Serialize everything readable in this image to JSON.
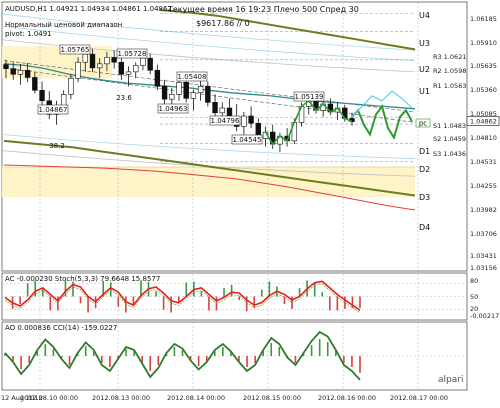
{
  "header": {
    "title": "AUDUSD,H1  1.04921 1.04934 1.04861 1.04862",
    "indicator_name": "Нормальный ценовой диапазон",
    "pivot_label": "pivot: 1.0491",
    "server_time": "Текущее время 16 19:23 Плечо 500 Спред 30",
    "balance": "$9617.86  // 0"
  },
  "colors": {
    "background": "#ffffff",
    "candle": "#111111",
    "ema_teal": "#2a8c8c",
    "ema_olive": "#6b7d1e",
    "ema_red": "#e0403a",
    "forecast_green": "#2e9a2e",
    "forecast_cyan": "#66ccee",
    "band_yellow": "#fff3c8",
    "osc_red": "#e02020",
    "hist_red": "#d84040",
    "hist_green": "#3a9a3a",
    "grid": "#9aa9c8"
  },
  "chart_data": [
    {
      "type": "candlestick",
      "title": "AUDUSD,H1",
      "price_axis": [
        "1.06185",
        "1.05910",
        "1.05635",
        "1.05360",
        "1.05085",
        "1.04810",
        "1.04531",
        "1.04255",
        "1.03982",
        "1.03706",
        "1.03431",
        "1.03156"
      ],
      "level_labels": [
        "U4",
        "U3",
        "U2",
        "U1",
        "D1",
        "D2",
        "D3",
        "D4"
      ],
      "pivot_labels": [
        "R3 1.0621",
        "R2 1.0598",
        "R1 1.0563",
        "S1 1.0483",
        "S2 1.0459",
        "S3 1.0436"
      ],
      "price_annotations": [
        "1.05765",
        "1.05728",
        "1.05408",
        "1.05139",
        "1.04963",
        "1.04796",
        "1.04867",
        "1.04545"
      ],
      "text_annotations": [
        "23.6",
        "38.2",
        "pc",
        "1.04862"
      ],
      "y_range": [
        1.03,
        1.0635
      ],
      "candles": [
        [
          1.0557,
          1.0563,
          1.054,
          1.0552
        ],
        [
          1.0552,
          1.056,
          1.0538,
          1.0545
        ],
        [
          1.0545,
          1.0558,
          1.0532,
          1.055
        ],
        [
          1.055,
          1.0559,
          1.0535,
          1.0541
        ],
        [
          1.0541,
          1.0548,
          1.0521,
          1.0525
        ],
        [
          1.0525,
          1.0536,
          1.0505,
          1.0512
        ],
        [
          1.0512,
          1.0524,
          1.0489,
          1.0495
        ],
        [
          1.0495,
          1.0512,
          1.0482,
          1.0505
        ],
        [
          1.0505,
          1.0525,
          1.0498,
          1.052
        ],
        [
          1.052,
          1.0545,
          1.0514,
          1.054
        ],
        [
          1.054,
          1.0566,
          1.0535,
          1.056
        ],
        [
          1.056,
          1.0578,
          1.0548,
          1.057
        ],
        [
          1.057,
          1.0577,
          1.0548,
          1.0553
        ],
        [
          1.0553,
          1.0565,
          1.054,
          1.0558
        ],
        [
          1.0558,
          1.0573,
          1.0549,
          1.0566
        ],
        [
          1.0566,
          1.0575,
          1.0552,
          1.056
        ],
        [
          1.056,
          1.0568,
          1.0538,
          1.0545
        ],
        [
          1.0545,
          1.0555,
          1.053,
          1.0548
        ],
        [
          1.0548,
          1.056,
          1.054,
          1.0556
        ],
        [
          1.0556,
          1.0573,
          1.055,
          1.0565
        ],
        [
          1.0565,
          1.0571,
          1.0545,
          1.055
        ],
        [
          1.055,
          1.0557,
          1.0525,
          1.053
        ],
        [
          1.053,
          1.0538,
          1.0508,
          1.0514
        ],
        [
          1.0514,
          1.0528,
          1.0496,
          1.052
        ],
        [
          1.052,
          1.0541,
          1.0512,
          1.0535
        ],
        [
          1.0535,
          1.054,
          1.051,
          1.0515
        ],
        [
          1.0515,
          1.0526,
          1.05,
          1.0522
        ],
        [
          1.0522,
          1.0538,
          1.0512,
          1.053
        ],
        [
          1.053,
          1.0536,
          1.0505,
          1.051
        ],
        [
          1.051,
          1.052,
          1.049,
          1.0497
        ],
        [
          1.0497,
          1.051,
          1.0482,
          1.0503
        ],
        [
          1.0503,
          1.0515,
          1.049,
          1.0492
        ],
        [
          1.0492,
          1.0508,
          1.0474,
          1.048
        ],
        [
          1.048,
          1.0498,
          1.047,
          1.0493
        ],
        [
          1.0493,
          1.0505,
          1.0478,
          1.0484
        ],
        [
          1.0484,
          1.049,
          1.0458,
          1.0465
        ],
        [
          1.0465,
          1.048,
          1.0455,
          1.0473
        ],
        [
          1.0473,
          1.0482,
          1.0452,
          1.0458
        ],
        [
          1.0458,
          1.0472,
          1.0448,
          1.0468
        ],
        [
          1.0468,
          1.0478,
          1.0455,
          1.0462
        ],
        [
          1.0462,
          1.049,
          1.0458,
          1.0485
        ],
        [
          1.0485,
          1.051,
          1.048,
          1.0505
        ],
        [
          1.0505,
          1.0516,
          1.0495,
          1.0512
        ],
        [
          1.0512,
          1.0514,
          1.0496,
          1.05
        ],
        [
          1.05,
          1.0513,
          1.0492,
          1.0508
        ],
        [
          1.0508,
          1.0515,
          1.0494,
          1.0498
        ],
        [
          1.0498,
          1.051,
          1.0488,
          1.0503
        ],
        [
          1.0503,
          1.0507,
          1.0486,
          1.049
        ],
        [
          1.049,
          1.0497,
          1.0481,
          1.0486
        ]
      ],
      "ema_teal": [
        1.0558,
        1.0556,
        1.0552,
        1.0546,
        1.0541,
        1.0537,
        1.0534,
        1.0532,
        1.053,
        1.0528,
        1.0525,
        1.0522,
        1.052,
        1.0518,
        1.0515,
        1.0512,
        1.051,
        1.0508,
        1.0506,
        1.0504,
        1.0502
      ],
      "ema_olive_upper": [
        1.0625,
        1.0622,
        1.0618,
        1.0612,
        1.0606,
        1.06,
        1.0594,
        1.0588,
        1.0582,
        1.0576
      ],
      "ema_olive_lower": [
        1.0462,
        1.0458,
        1.0454,
        1.0448,
        1.0442,
        1.0436,
        1.043,
        1.0424,
        1.0418,
        1.0412,
        1.0406,
        1.04,
        1.0394
      ],
      "ema_red": [
        1.0432,
        1.0431,
        1.043,
        1.0429,
        1.0428,
        1.0426,
        1.0424,
        1.0421,
        1.0418,
        1.0415,
        1.041,
        1.0405,
        1.0399,
        1.0393,
        1.0387,
        1.0381,
        1.0376
      ],
      "forecast_green": [
        1.0492,
        1.05,
        1.0482,
        1.047,
        1.0495,
        1.0505,
        1.0478,
        1.0466,
        1.0492,
        1.05,
        1.0486
      ],
      "forecast_cyan": [
        1.0492,
        1.0505,
        1.0518,
        1.0512,
        1.0524,
        1.0515,
        1.0503
      ]
    },
    {
      "type": "line",
      "title": "AC -0.000230  Stoch(5,3,3) 79.6648 15.8577",
      "y_axis": [
        "80",
        "50",
        "20",
        "-0.00217"
      ],
      "ylim": [
        0,
        100
      ],
      "series": [
        {
          "name": "Stoch(5,3,3)",
          "values": [
            48,
            35,
            28,
            42,
            62,
            70,
            55,
            40,
            62,
            78,
            72,
            50,
            38,
            55,
            70,
            60,
            38,
            30,
            52,
            68,
            72,
            58,
            40,
            35,
            50,
            66,
            70,
            55,
            40,
            48,
            60,
            58,
            42,
            30,
            36,
            52,
            62,
            55,
            42,
            50,
            68,
            82,
            85,
            70,
            55,
            42,
            30,
            18
          ]
        }
      ]
    },
    {
      "type": "line",
      "title": "AO 0.000836  CCI(14) -159.0227",
      "x_axis": [
        "12 Aug 2012",
        "2012.08.10 00:00",
        "2012.08.13 00:00",
        "2012.08.14 00:00",
        "2012.08.15 00:00",
        "2012.08.16 00:00",
        "2012.08.17 00:00"
      ],
      "series": [
        {
          "name": "CCI(14)",
          "values": [
            20,
            -40,
            -120,
            -60,
            40,
            110,
            60,
            -20,
            -80,
            20,
            90,
            40,
            -60,
            -100,
            -20,
            60,
            40,
            -50,
            -140,
            -80,
            20,
            80,
            50,
            -30,
            -90,
            -40,
            40,
            80,
            30,
            -40,
            -100,
            -60,
            40,
            120,
            80,
            -10,
            -60,
            20,
            100,
            160,
            130,
            40,
            -60,
            -100,
            -159
          ]
        }
      ]
    }
  ],
  "watermark": "alpari"
}
